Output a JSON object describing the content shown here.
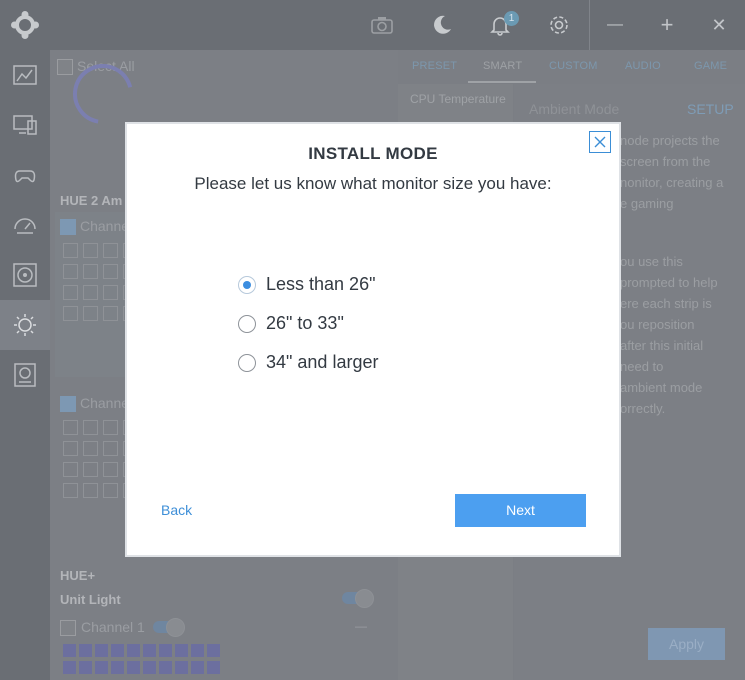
{
  "topbar": {
    "icons": [
      "app-logo-icon",
      "camera-icon",
      "moon-icon",
      "bell-icon",
      "gear-icon"
    ],
    "notification_count": "1",
    "window_buttons": {
      "minimize": "—",
      "maximize": "+",
      "close": "✕"
    }
  },
  "sidebar": {
    "items": [
      {
        "icon": "dashboard-icon"
      },
      {
        "icon": "monitor-icon"
      },
      {
        "icon": "gamepad-icon"
      },
      {
        "icon": "speedometer-icon"
      },
      {
        "icon": "fan-icon"
      },
      {
        "icon": "lighting-icon",
        "active": true
      },
      {
        "icon": "gpu-icon"
      }
    ]
  },
  "left_panel": {
    "select_all": "Select All",
    "device1_title": "HUE 2 Am",
    "device1_channel1": "Channe",
    "device1_channel2": "Channe",
    "device2_title": "HUE+",
    "unit_light": "Unit Light",
    "channel1": "Channel 1",
    "collapse": "—"
  },
  "right_panel": {
    "tabs": [
      "PRESET",
      "SMART",
      "CUSTOM",
      "AUDIO",
      "GAME"
    ],
    "active_tab": "SMART",
    "list_item": "CPU Temperature",
    "ambient_mode": "Ambient Mode",
    "setup": "SETUP",
    "desc_lines": [
      "node projects the",
      "screen from the",
      "nonitor, creating a",
      "e gaming",
      "",
      "ou use this",
      "prompted to help",
      "ere each strip is",
      "ou reposition",
      "after this initial",
      "need to",
      "ambient mode",
      "orrectly."
    ],
    "apply": "Apply"
  },
  "modal": {
    "title": "INSTALL MODE",
    "subtitle": "Please let us know what monitor size you have:",
    "options": [
      "Less than 26\"",
      "26\" to 33\"",
      "34\" and larger"
    ],
    "selected_option": "Less than 26\"",
    "back": "Back",
    "next": "Next"
  },
  "colors": {
    "accent": "#4c9ff0",
    "link": "#3e8fd8",
    "overlay": "#6a6e74"
  }
}
